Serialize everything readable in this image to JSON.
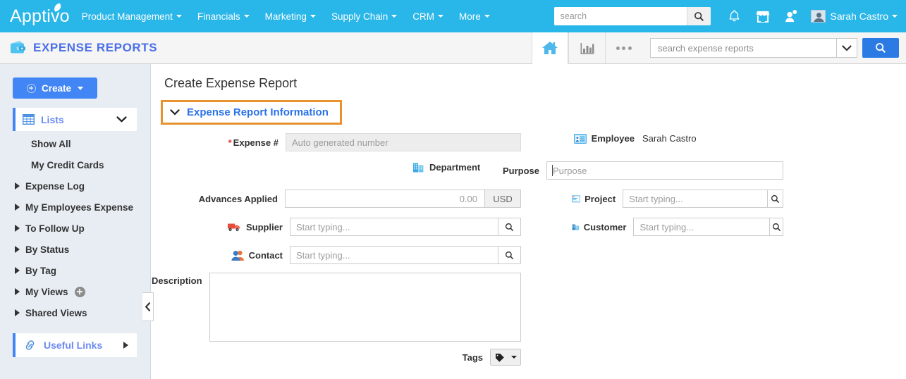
{
  "topnav": {
    "brand": "Apptivo",
    "items": [
      {
        "label": "Product Management",
        "caret": true
      },
      {
        "label": "Financials",
        "caret": true
      },
      {
        "label": "Marketing",
        "caret": true
      },
      {
        "label": "Supply Chain",
        "caret": true
      },
      {
        "label": "CRM",
        "caret": true
      },
      {
        "label": "More",
        "caret": true
      }
    ],
    "global_search_placeholder": "search",
    "global_search_value": "",
    "icons": [
      "search-icon",
      "bell-icon",
      "store-icon",
      "add-user-icon"
    ],
    "user": "Sarah Castro",
    "bar_color": "#29B6E8"
  },
  "appheader": {
    "title": "EXPENSE REPORTS",
    "title_icon": "wallet-icon",
    "title_color": "#4B6FE8",
    "tools": [
      {
        "name": "home-icon",
        "active": true
      },
      {
        "name": "reports-bar-chart-icon",
        "active": false
      },
      {
        "name": "more-ellipsis-icon",
        "active": false
      }
    ],
    "search_placeholder": "search expense reports",
    "search_value": "",
    "search_button_color": "#2C7BE5"
  },
  "sidebar": {
    "create_label": "Create",
    "create_color": "#4285F4",
    "lists_label": "Lists",
    "items": [
      {
        "label": "Show All",
        "expandable": false,
        "add": false
      },
      {
        "label": "My Credit Cards",
        "expandable": false,
        "add": false
      },
      {
        "label": "Expense Log",
        "expandable": true,
        "add": false
      },
      {
        "label": "My Employees Expense",
        "expandable": true,
        "add": false
      },
      {
        "label": "To Follow Up",
        "expandable": true,
        "add": false
      },
      {
        "label": "By Status",
        "expandable": true,
        "add": false
      },
      {
        "label": "By Tag",
        "expandable": true,
        "add": false
      },
      {
        "label": "My Views",
        "expandable": true,
        "add": true
      },
      {
        "label": "Shared Views",
        "expandable": true,
        "add": false
      }
    ],
    "useful_links_label": "Useful Links"
  },
  "main": {
    "page_title": "Create Expense Report",
    "section_title": "Expense Report Information",
    "section_highlight_color": "#E8922E",
    "fields": {
      "expense_no": {
        "label": "Expense #",
        "required": true,
        "placeholder": "Auto generated number",
        "value": "",
        "readonly": true
      },
      "department": {
        "label": "Department",
        "icon": "building-icon",
        "value": ""
      },
      "advances_applied": {
        "label": "Advances Applied",
        "placeholder": "0.00",
        "value": "",
        "currency": "USD"
      },
      "supplier": {
        "label": "Supplier",
        "icon": "truck-icon",
        "placeholder": "Start typing...",
        "value": "",
        "search_icon": "search-icon"
      },
      "contact": {
        "label": "Contact",
        "icon": "contacts-icon",
        "placeholder": "Start typing...",
        "value": "",
        "search_icon": "search-icon"
      },
      "description": {
        "label": "Description",
        "placeholder": "",
        "value": ""
      },
      "tags": {
        "label": "Tags",
        "icon": "tag-icon"
      },
      "employee": {
        "label": "Employee",
        "icon": "id-card-icon",
        "value": "Sarah Castro"
      },
      "purpose": {
        "label": "Purpose",
        "placeholder": "Purpose",
        "value": "",
        "focused": true
      },
      "project": {
        "label": "Project",
        "icon": "project-icon",
        "placeholder": "Start typing...",
        "value": "",
        "search_icon": "search-icon"
      },
      "customer": {
        "label": "Customer",
        "icon": "customer-building-icon",
        "placeholder": "Start typing...",
        "value": "",
        "search_icon": "search-icon"
      }
    }
  }
}
